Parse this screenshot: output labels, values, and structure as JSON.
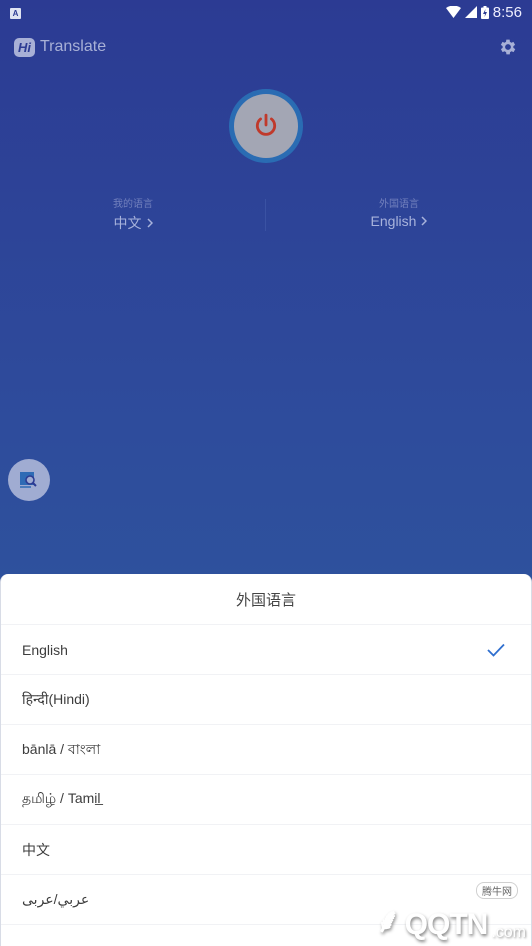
{
  "status_bar": {
    "notification_icon": "a-notification-icon",
    "time": "8:56",
    "icons": [
      "wifi-icon",
      "signal-icon",
      "battery-charging-icon"
    ]
  },
  "header": {
    "logo_text": "Hi",
    "app_name": "Translate",
    "settings_icon": "gear-icon"
  },
  "power": {
    "icon": "power-icon",
    "ring_color": "#2a6cb3",
    "icon_color": "#c0392b"
  },
  "languages": {
    "mine": {
      "label": "我的语言",
      "value": "中文"
    },
    "foreign": {
      "label": "外国语言",
      "value": "English"
    }
  },
  "ocr_button": {
    "icon": "image-search-icon"
  },
  "sheet": {
    "title": "外国语言",
    "items": [
      {
        "label": "English",
        "selected": true
      },
      {
        "label": "हिन्दी(Hindi)",
        "selected": false
      },
      {
        "label": "bānlā / বাংলা",
        "selected": false
      },
      {
        "label": "தமிழ் / Tamil̲",
        "selected": false
      },
      {
        "label": "中文",
        "selected": false
      },
      {
        "label": "عربي/عربى",
        "selected": false
      }
    ],
    "check_color": "#2f6fcf"
  },
  "watermark": {
    "text": "QQTN",
    "suffix": ".com",
    "cn": "腾牛网"
  }
}
